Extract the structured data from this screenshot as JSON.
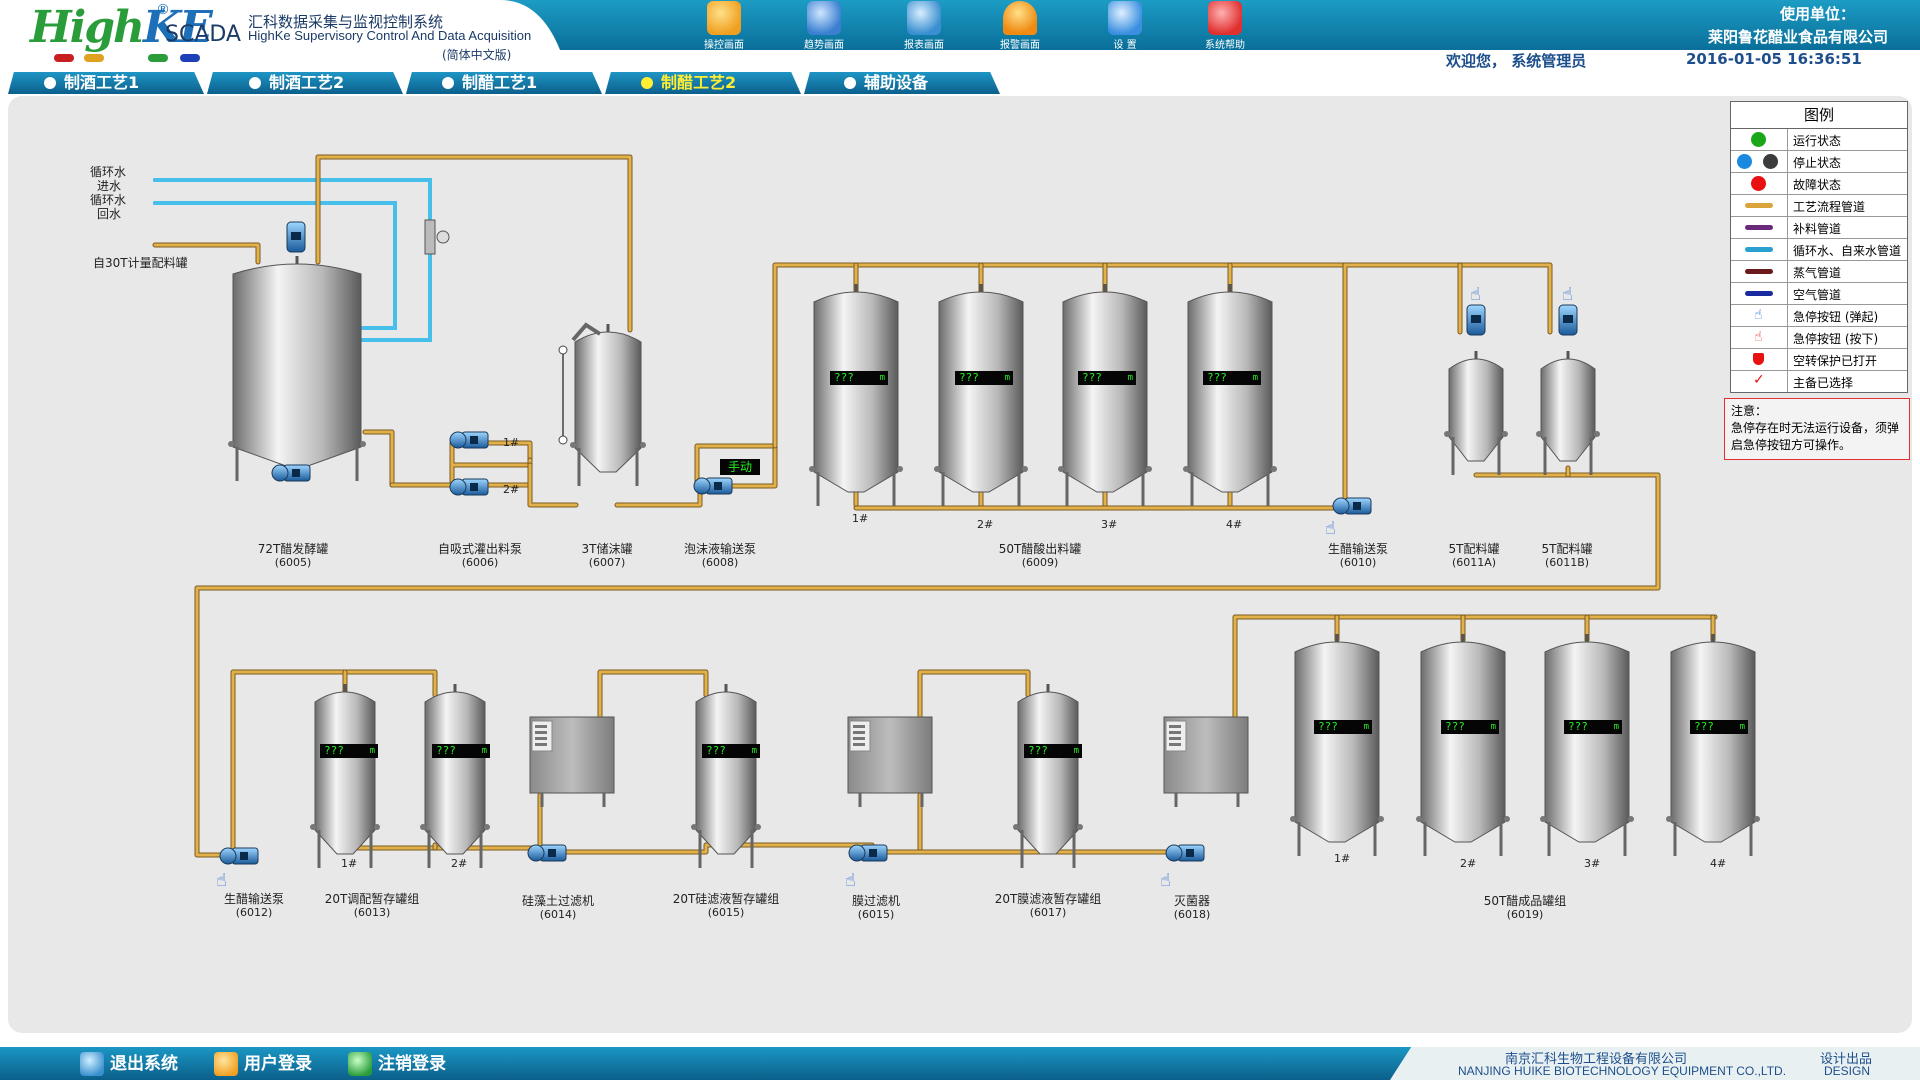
{
  "header": {
    "logo_high": "High",
    "logo_ke": "KE",
    "logo_reg": "®",
    "scada": "SCADA",
    "system_title_cn": "汇科数据采集与监视控制系统",
    "system_title_en": "HighKe Supervisory Control And Data Acquisition",
    "version": "(简体中文版)",
    "owner_label": "使用单位：",
    "owner_name": "莱阳鲁花醋业食品有限公司",
    "welcome": "欢迎您，  系统管理员",
    "datetime": "2016-01-05   16:36:51",
    "buttons": [
      {
        "label": "操控画面",
        "icon": "hand-control-icon",
        "color": "#f0a020"
      },
      {
        "label": "趋势画面",
        "icon": "magnifier-trend-icon",
        "color": "#3a7fd0"
      },
      {
        "label": "报表画面",
        "icon": "report-globe-icon",
        "color": "#3a8fd0"
      },
      {
        "label": "报警画面",
        "icon": "alarm-bell-icon",
        "color": "#f0a020"
      },
      {
        "label": "设    置",
        "icon": "settings-tools-icon",
        "color": "#3a8fe0"
      },
      {
        "label": "系统帮助",
        "icon": "help-icon",
        "color": "#e03030"
      }
    ]
  },
  "tabs": [
    {
      "label": "制酒工艺1",
      "active": false
    },
    {
      "label": "制酒工艺2",
      "active": false
    },
    {
      "label": "制醋工艺1",
      "active": false
    },
    {
      "label": "制醋工艺2",
      "active": true
    },
    {
      "label": "辅助设备",
      "active": false
    }
  ],
  "process": {
    "side_labels": [
      "循环水",
      "进水",
      "循环水",
      "回水",
      "自30T计量配料罐"
    ],
    "pump_numbers": [
      "1#",
      "2#"
    ],
    "manual_mode": "手动",
    "readout_value": "???",
    "readout_unit": "m",
    "equipment": [
      {
        "name": "72T醋发酵罐",
        "code": "(6005)"
      },
      {
        "name": "自吸式灌出料泵",
        "code": "(6006)"
      },
      {
        "name": "3T储沫罐",
        "code": "(6007)"
      },
      {
        "name": "泡沫液输送泵",
        "code": "(6008)"
      },
      {
        "name": "50T醋酸出料罐",
        "code": "(6009)"
      },
      {
        "name": "生醋输送泵",
        "code": "(6010)"
      },
      {
        "name": "5T配料罐",
        "code": "(6011A)"
      },
      {
        "name": "5T配料罐",
        "code": "(6011B)"
      },
      {
        "name": "生醋输送泵",
        "code": "(6012)"
      },
      {
        "name": "20T调配暂存罐组",
        "code": "(6013)"
      },
      {
        "name": "硅藻土过滤机",
        "code": "(6014)"
      },
      {
        "name": "20T硅滤液暂存罐组",
        "code": "(6015)"
      },
      {
        "name": "膜过滤机",
        "code": "(6015)"
      },
      {
        "name": "20T膜滤液暂存罐组",
        "code": "(6017)"
      },
      {
        "name": "灭菌器",
        "code": "(6018)"
      },
      {
        "name": "50T醋成品罐组",
        "code": "(6019)"
      }
    ],
    "tank_numbers": [
      "1#",
      "2#",
      "3#",
      "4#"
    ]
  },
  "legend": {
    "title": "图例",
    "items": [
      {
        "label": "运行状态",
        "icon": "running-status-icon",
        "color": "#1aa81a"
      },
      {
        "label": "停止状态",
        "icon": "stopped-status-icon",
        "color": "#1a8ae0"
      },
      {
        "label": "故障状态",
        "icon": "fault-status-icon",
        "color": "#e81010"
      },
      {
        "label": "工艺流程管道",
        "icon": "process-pipe-icon",
        "color": "#d9a53a"
      },
      {
        "label": "补料管道",
        "icon": "feed-pipe-icon",
        "color": "#6a2a7a"
      },
      {
        "label": "循环水、自来水管道",
        "icon": "water-pipe-icon",
        "color": "#2aa0d0"
      },
      {
        "label": "蒸气管道",
        "icon": "steam-pipe-icon",
        "color": "#6a1a1a"
      },
      {
        "label": "空气管道",
        "icon": "air-pipe-icon",
        "color": "#1a2aa0"
      },
      {
        "label": "急停按钮 (弹起)",
        "icon": "emergency-stop-released-icon",
        "color": "#2a6fd0"
      },
      {
        "label": "急停按钮 (按下)",
        "icon": "emergency-stop-pressed-icon",
        "color": "#e03030"
      },
      {
        "label": "空转保护已打开",
        "icon": "dry-run-protection-icon",
        "color": "#e81010"
      },
      {
        "label": "主备已选择",
        "icon": "primary-backup-check-icon",
        "color": "#e81010"
      }
    ]
  },
  "notice": {
    "title": "注意：",
    "body": "急停存在时无法运行设备，须弹启急停按钮方可操作。"
  },
  "footer": {
    "buttons": [
      "退出系统",
      "用户登录",
      "注销登录"
    ],
    "company_cn": "南京汇科生物工程设备有限公司",
    "company_en": "NANJING HUIKE BIOTECHNOLOGY EQUIPMENT CO.,LTD.",
    "design_cn": "设计出品",
    "design_en": "DESIGN"
  }
}
